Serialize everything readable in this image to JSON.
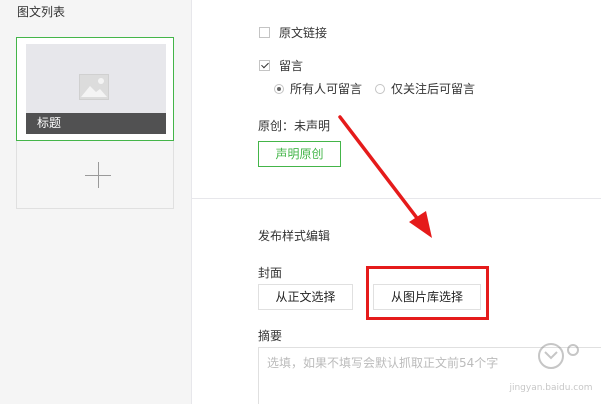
{
  "left_panel": {
    "title": "图文列表",
    "card": {
      "caption": "标题"
    }
  },
  "options": {
    "original_link": "原文链接",
    "comments": "留言",
    "comment_all": "所有人可留言",
    "comment_followers": "仅关注后可留言",
    "original_status": "原创：未声明",
    "declare_original_button": "声明原创"
  },
  "publish": {
    "section_title": "发布样式编辑",
    "cover_label": "封面",
    "from_body_button": "从正文选择",
    "from_library_button": "从图片库选择",
    "summary_label": "摘要",
    "summary_placeholder": "选填，如果不填写会默认抓取正文前54个字"
  },
  "watermark": {
    "text": "jingyan.baidu.com"
  },
  "colors": {
    "accent_green": "#44b549",
    "annotation_red": "#e51b1b"
  }
}
